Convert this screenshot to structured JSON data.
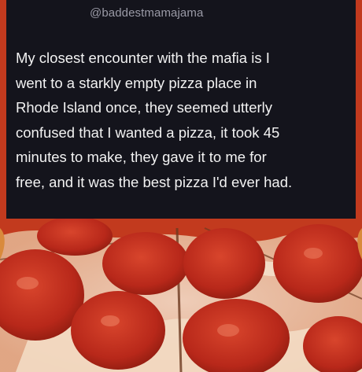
{
  "tweet": {
    "handle": "@baddestmamajama",
    "text_lines": [
      "My closest encounter with the mafia is I",
      "went to a starkly empty pizza place in",
      "Rhode Island once, they seemed utterly",
      "confused that I wanted a pizza, it took 45",
      "minutes to make, they gave it to me for",
      "free, and it was the best pizza I'd ever had."
    ]
  },
  "photo": {
    "subject": "pepperoni-pizza-icon",
    "colors": {
      "sauce": "#c23a1e",
      "pepperoni": "#b8281a",
      "cheese": "#f1d9c0",
      "crust": "#d98a3c",
      "card_background": "#14141c",
      "handle_text": "#9a9aa6",
      "body_text": "#f2f2f2"
    }
  }
}
